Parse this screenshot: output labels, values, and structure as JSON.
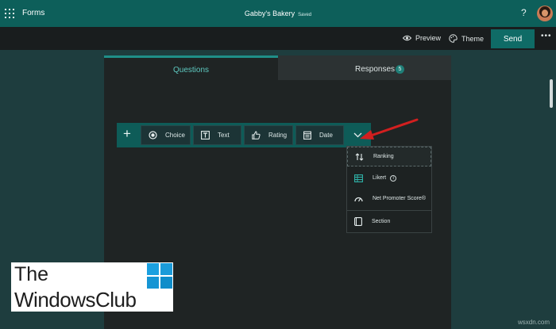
{
  "app": {
    "name": "Forms",
    "doc_title": "Gabby's Bakery",
    "status": "Saved"
  },
  "header": {
    "help_label": "?"
  },
  "command_bar": {
    "preview_label": "Preview",
    "theme_label": "Theme",
    "send_label": "Send",
    "more_label": "•••"
  },
  "tabs": {
    "questions_label": "Questions",
    "responses_label": "Responses",
    "responses_count": "5"
  },
  "toolbar": {
    "add_label": "+",
    "items": [
      {
        "label": "Choice",
        "icon": "radio-icon"
      },
      {
        "label": "Text",
        "icon": "text-icon"
      },
      {
        "label": "Rating",
        "icon": "thumbs-up-icon"
      },
      {
        "label": "Date",
        "icon": "calendar-icon"
      }
    ],
    "more_icon": "chevron-down-icon"
  },
  "dropdown": {
    "items": [
      {
        "label": "Ranking",
        "icon": "sort-arrows-icon"
      },
      {
        "label": "Likert",
        "icon": "grid-icon",
        "info": "i"
      },
      {
        "label": "Net Promoter Score®",
        "icon": "gauge-icon"
      },
      {
        "label": "Section",
        "icon": "section-icon"
      }
    ]
  },
  "watermark": {
    "line1": "The",
    "line2": "WindowsClub",
    "credit": "wsxdn.com"
  },
  "colors": {
    "brand": "#0d5f5a",
    "accent": "#1f8f88",
    "arrow": "#d21f1f"
  }
}
